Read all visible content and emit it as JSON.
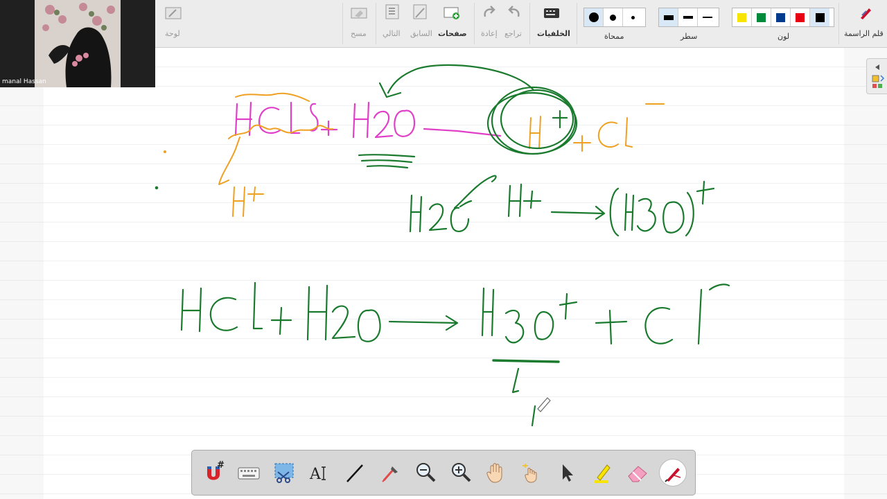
{
  "webcam": {
    "participant_name": "manal Hassan"
  },
  "ribbon": {
    "pen": {
      "label": "قلم الراسمة"
    },
    "color": {
      "label": "لون",
      "swatches": [
        "#000000",
        "#e60012",
        "#003b8e",
        "#008a3a",
        "#f7e400"
      ]
    },
    "line": {
      "label": "سطر"
    },
    "eraser": {
      "label": "ممحاة"
    },
    "backgrounds": {
      "label": "الخلفيات"
    },
    "undo": {
      "label": "تراجع"
    },
    "redo": {
      "label": "إعادة"
    },
    "pages": {
      "label": "صفحات"
    },
    "previous": {
      "label": "السابق"
    },
    "next": {
      "label": "التالي"
    },
    "clear": {
      "label": "مسح"
    },
    "board": {
      "label": "لوحة"
    }
  },
  "canvas": {
    "equations": [
      "HCl + H2O → H+ + Cl-",
      "H2O + H+ → (H3O)+",
      "HCl + H2O → H3O+ + Cl-"
    ],
    "side_note": "H+",
    "ink_colors": {
      "green": "#1a7a2e",
      "magenta": "#e040c8",
      "orange": "#f0a020"
    }
  },
  "bottom_toolbar": {
    "tools": [
      "magnet-hash-tool",
      "keyboard-tool",
      "screen-capture-tool",
      "text-tool",
      "line-tool",
      "color-picker-tool",
      "zoom-out-tool",
      "zoom-in-tool",
      "pan-hand-tool",
      "laser-pointer-tool",
      "select-arrow-tool",
      "highlighter-tool",
      "eraser-tool",
      "pen-tool"
    ]
  }
}
